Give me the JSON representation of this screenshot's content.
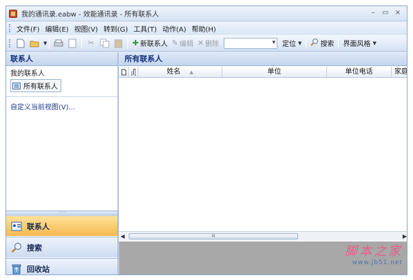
{
  "window": {
    "title": "我的通讯录.eabw - 效能通讯录 - 所有联系人",
    "minimize": "–",
    "restore": "▭",
    "close": "×"
  },
  "menu": [
    "文件(F)",
    "编辑(E)",
    "视图(V)",
    "转到(G)",
    "工具(T)",
    "动作(A)",
    "帮助(H)"
  ],
  "toolbar": {
    "new_contact": "新联系人",
    "edit": "编辑",
    "delete": "删除",
    "locate": "定位",
    "search": "搜索",
    "skin": "界面风格"
  },
  "left_pane": {
    "header": "联系人",
    "my_contacts": "我的联系人",
    "all_contacts": "所有联系人",
    "customize_view": "自定义当前视图(V)...",
    "nav": {
      "contacts": "联系人",
      "search": "搜索",
      "recycle": "回收站"
    }
  },
  "right_pane": {
    "header": "所有联系人",
    "columns": [
      "姓名",
      "单位",
      "单位电话",
      "家庭"
    ],
    "scroll_thumb": "III"
  },
  "watermark": {
    "cn": "脚本之家",
    "url": "www.jb51.net"
  },
  "colors": {
    "accent_nav_active": "#f6b851",
    "header_text": "#15317e"
  }
}
